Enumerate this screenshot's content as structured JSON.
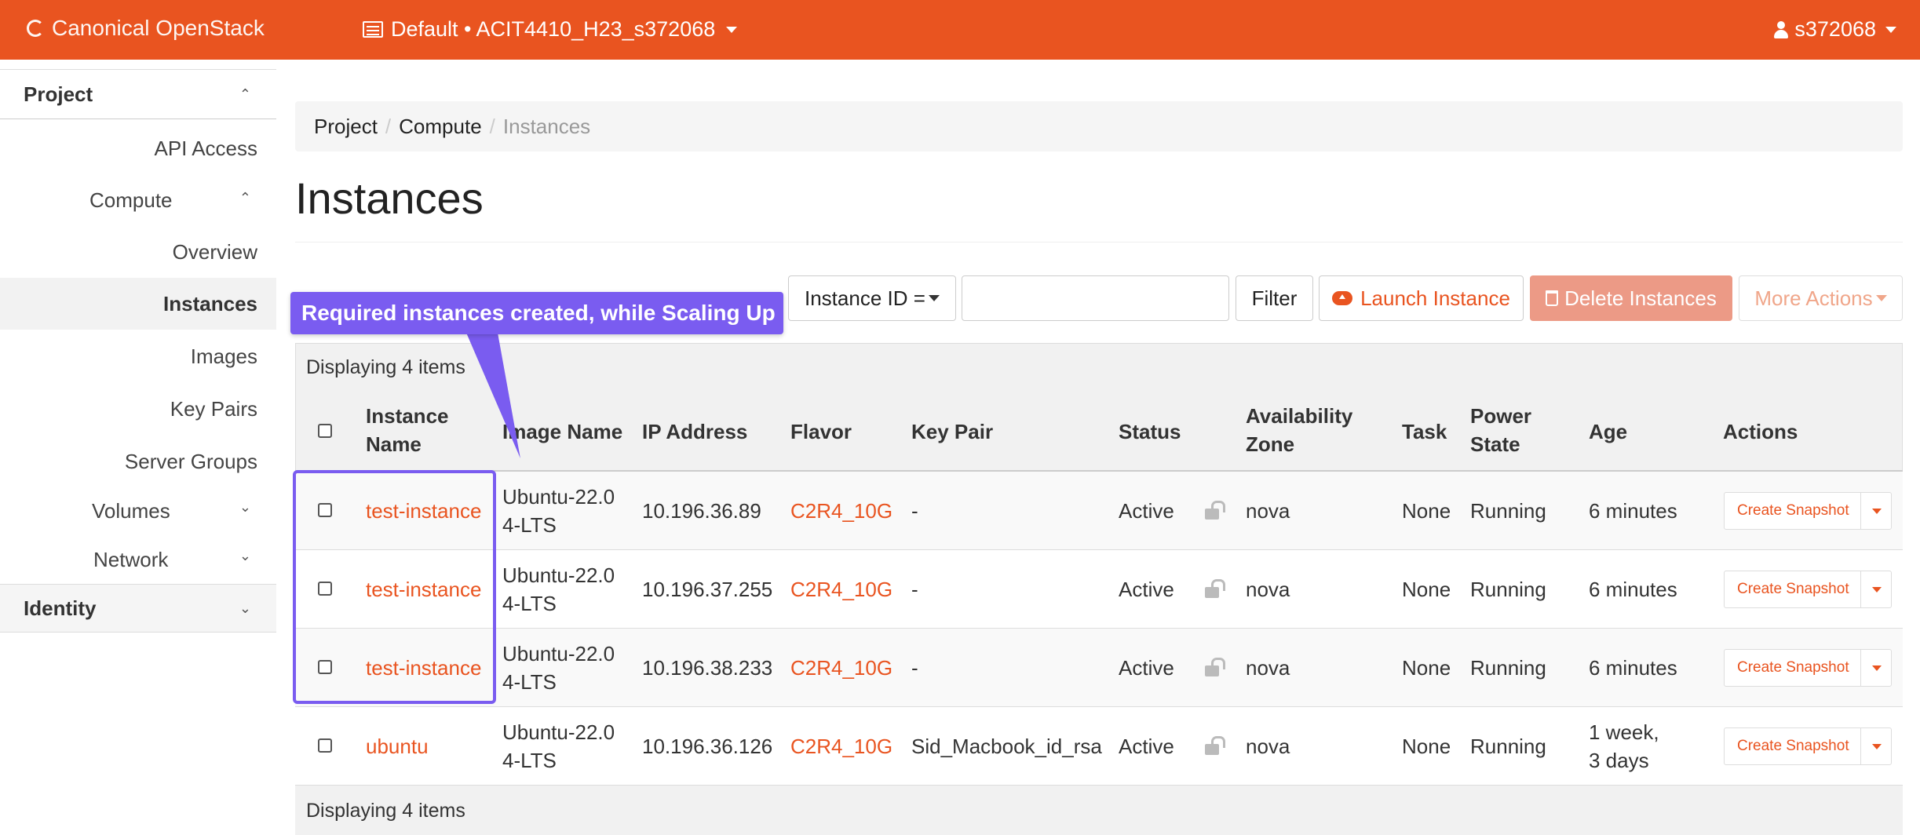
{
  "navbar": {
    "brand": "Canonical OpenStack",
    "project_switcher": "Default • ACIT4410_H23_s372068",
    "user": "s372068",
    "colors": {
      "bar": "#e95420"
    }
  },
  "sidebar": {
    "project_label": "Project",
    "api_access": "API Access",
    "compute_label": "Compute",
    "compute_items": [
      "Overview",
      "Instances",
      "Images",
      "Key Pairs",
      "Server Groups"
    ],
    "volumes_label": "Volumes",
    "network_label": "Network",
    "identity_label": "Identity",
    "active_item": "Instances"
  },
  "breadcrumb": [
    "Project",
    "Compute",
    "Instances"
  ],
  "page_title": "Instances",
  "toolbar": {
    "filter_field": "Instance ID =",
    "filter_value": "",
    "filter_button": "Filter",
    "launch_button": "Launch Instance",
    "delete_button": "Delete Instances",
    "more_button": "More Actions"
  },
  "annotation": {
    "callout": "Required instances created, while Scaling Up",
    "color": "#7a5cf0"
  },
  "table": {
    "displaying_top": "Displaying 4 items",
    "displaying_bottom": "Displaying 4 items",
    "headers": {
      "instance_name": [
        "Instance",
        "Name"
      ],
      "image_name": "Image Name",
      "ip_address": "IP Address",
      "flavor": "Flavor",
      "key_pair": "Key Pair",
      "status": "Status",
      "availability_zone": [
        "Availability",
        "Zone"
      ],
      "task": "Task",
      "power_state": [
        "Power",
        "State"
      ],
      "age": "Age",
      "actions": "Actions"
    },
    "rows": [
      {
        "name": "test-instance",
        "image": [
          "Ubuntu-22.0",
          "4-LTS"
        ],
        "ip": "10.196.36.89",
        "flavor": "C2R4_10G",
        "key_pair": "-",
        "status": "Active",
        "zone": "nova",
        "task": "None",
        "power": "Running",
        "age": [
          "6 minutes",
          ""
        ],
        "action": "Create Snapshot"
      },
      {
        "name": "test-instance",
        "image": [
          "Ubuntu-22.0",
          "4-LTS"
        ],
        "ip": "10.196.37.255",
        "flavor": "C2R4_10G",
        "key_pair": "-",
        "status": "Active",
        "zone": "nova",
        "task": "None",
        "power": "Running",
        "age": [
          "6 minutes",
          ""
        ],
        "action": "Create Snapshot"
      },
      {
        "name": "test-instance",
        "image": [
          "Ubuntu-22.0",
          "4-LTS"
        ],
        "ip": "10.196.38.233",
        "flavor": "C2R4_10G",
        "key_pair": "-",
        "status": "Active",
        "zone": "nova",
        "task": "None",
        "power": "Running",
        "age": [
          "6 minutes",
          ""
        ],
        "action": "Create Snapshot"
      },
      {
        "name": "ubuntu",
        "image": [
          "Ubuntu-22.0",
          "4-LTS"
        ],
        "ip": "10.196.36.126",
        "flavor": "C2R4_10G",
        "key_pair": "Sid_Macbook_id_rsa",
        "status": "Active",
        "zone": "nova",
        "task": "None",
        "power": "Running",
        "age": [
          "1 week,",
          "3 days"
        ],
        "action": "Create Snapshot"
      }
    ]
  }
}
